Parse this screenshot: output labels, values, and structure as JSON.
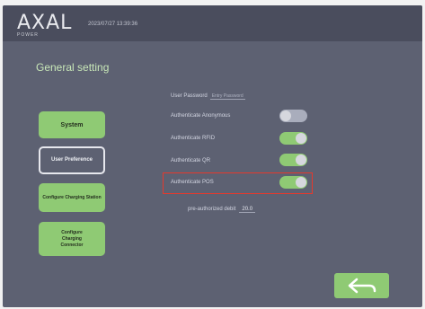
{
  "header": {
    "logo_text": "AXAL",
    "logo_sub": "POWER",
    "datetime": "2023/07/27 13:39:36"
  },
  "page": {
    "title": "General setting"
  },
  "nav": {
    "system": "System",
    "user_preference": "User Preference",
    "configure_charging_station": "Configure Charging Station",
    "configure_charging_connector": "Configure Charging Connector"
  },
  "settings": {
    "user_password_label": "User Password",
    "user_password_placeholder": "Entry Password",
    "items": [
      {
        "label": "Authenticate Anonymous",
        "enabled": false
      },
      {
        "label": "Authenticate RFID",
        "enabled": true
      },
      {
        "label": "Authenticate QR",
        "enabled": true
      },
      {
        "label": "Authenticate POS",
        "enabled": true
      }
    ],
    "preauth_label": "pre-authorized debit",
    "preauth_value": "20.0"
  },
  "icons": {
    "back": "back-arrow-icon"
  },
  "colors": {
    "background": "#5d6172",
    "accent_green": "#8fca74",
    "highlight_red": "#e43a2d"
  }
}
